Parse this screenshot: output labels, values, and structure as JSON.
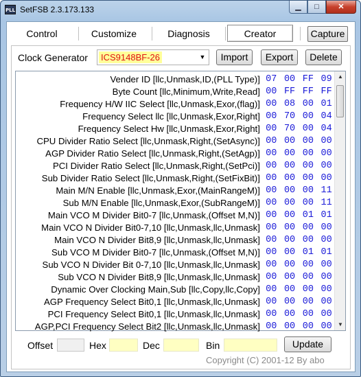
{
  "window": {
    "app_icon_text": "PLL",
    "title": "SetFSB 2.3.173.133",
    "controls": {
      "minimize": "▁",
      "maximize": "□",
      "close": "✕"
    }
  },
  "tabs": [
    {
      "label": "Control",
      "active": false
    },
    {
      "label": "Customize",
      "active": false
    },
    {
      "label": "Diagnosis",
      "active": false
    },
    {
      "label": "Creator",
      "active": true
    }
  ],
  "capture_label": "Capture",
  "clock_generator": {
    "label": "Clock Generator",
    "selected": "ICS9148BF-26",
    "highlight_color": "#ffff99",
    "text_color": "#e01010"
  },
  "buttons": {
    "import": "Import",
    "export": "Export",
    "delete": "Delete",
    "update": "Update"
  },
  "registers": [
    {
      "desc": "Vender ID [llc,Unmask,ID,(PLL Type)]",
      "vals": [
        "07",
        "00",
        "FF",
        "09"
      ]
    },
    {
      "desc": "Byte Count [llc,Minimum,Write,Read]",
      "vals": [
        "00",
        "FF",
        "FF",
        "FF"
      ]
    },
    {
      "desc": "Frequency H/W IIC Select [llc,Unmask,Exor,(flag)]",
      "vals": [
        "00",
        "08",
        "00",
        "01"
      ]
    },
    {
      "desc": "Frequency Select llc [llc,Unmask,Exor,Right]",
      "vals": [
        "00",
        "70",
        "00",
        "04"
      ]
    },
    {
      "desc": "Frequency Select Hw [llc,Unmask,Exor,Right]",
      "vals": [
        "00",
        "70",
        "00",
        "04"
      ]
    },
    {
      "desc": "CPU Divider Ratio Select [llc,Unmask,Right,(SetAsync)]",
      "vals": [
        "00",
        "00",
        "00",
        "00"
      ]
    },
    {
      "desc": "AGP Divider Ratio Select [llc,Unmask,Right,(SetAgp)]",
      "vals": [
        "00",
        "00",
        "00",
        "00"
      ]
    },
    {
      "desc": "PCI Divider Ratio Select [llc,Unmask,Right,(SetPci)]",
      "vals": [
        "00",
        "00",
        "00",
        "00"
      ]
    },
    {
      "desc": "Sub Divider Ratio Select [llc,Unmask,Right,(SetFixBit)]",
      "vals": [
        "00",
        "00",
        "00",
        "00"
      ]
    },
    {
      "desc": "Main M/N Enable [llc,Unmask,Exor,(MainRangeM)]",
      "vals": [
        "00",
        "00",
        "00",
        "11"
      ]
    },
    {
      "desc": "Sub M/N Enable [llc,Unmask,Exor,(SubRangeM)]",
      "vals": [
        "00",
        "00",
        "00",
        "11"
      ]
    },
    {
      "desc": "Main VCO M Divider Bit0-7 [llc,Unmask,(Offset M,N)]",
      "vals": [
        "00",
        "00",
        "01",
        "01"
      ]
    },
    {
      "desc": "Main VCO N Divider Bit0-7,10 [llc,Unmask,llc,Unmask]",
      "vals": [
        "00",
        "00",
        "00",
        "00"
      ]
    },
    {
      "desc": "Main VCO N Divider Bit8,9 [llc,Unmask,llc,Unmask]",
      "vals": [
        "00",
        "00",
        "00",
        "00"
      ]
    },
    {
      "desc": "Sub VCO M Divider Bit0-7 [llc,Unmask,(Offset M,N)]",
      "vals": [
        "00",
        "00",
        "01",
        "01"
      ]
    },
    {
      "desc": "Sub VCO N Divider Bit 0-7,10 [llc,Unmask,llc,Unmask]",
      "vals": [
        "00",
        "00",
        "00",
        "00"
      ]
    },
    {
      "desc": "Sub VCO N Divider  Bit8,9 [llc,Unmask,llc,Unmask]",
      "vals": [
        "00",
        "00",
        "00",
        "00"
      ]
    },
    {
      "desc": "Dynamic Over Clocking Main,Sub [llc,Copy,llc,Copy]",
      "vals": [
        "00",
        "00",
        "00",
        "00"
      ]
    },
    {
      "desc": "AGP Frequency Select Bit0,1 [llc,Unmask,llc,Unmask]",
      "vals": [
        "00",
        "00",
        "00",
        "00"
      ]
    },
    {
      "desc": "PCI Frequency Select Bit0,1 [llc,Unmask,llc,Unmask]",
      "vals": [
        "00",
        "00",
        "00",
        "00"
      ]
    },
    {
      "desc": "AGP,PCI Frequency Select Bit2 [llc,Unmask,llc,Unmask]",
      "vals": [
        "00",
        "00",
        "00",
        "00"
      ]
    }
  ],
  "value_color": "#1a1ad8",
  "bottom": {
    "offset_label": "Offset",
    "offset_value": "",
    "hex_label": "Hex",
    "hex_value": "",
    "dec_label": "Dec",
    "dec_value": "",
    "bin_label": "Bin",
    "bin_value": ""
  },
  "copyright": "Copyright (C) 2001-12 By abo"
}
